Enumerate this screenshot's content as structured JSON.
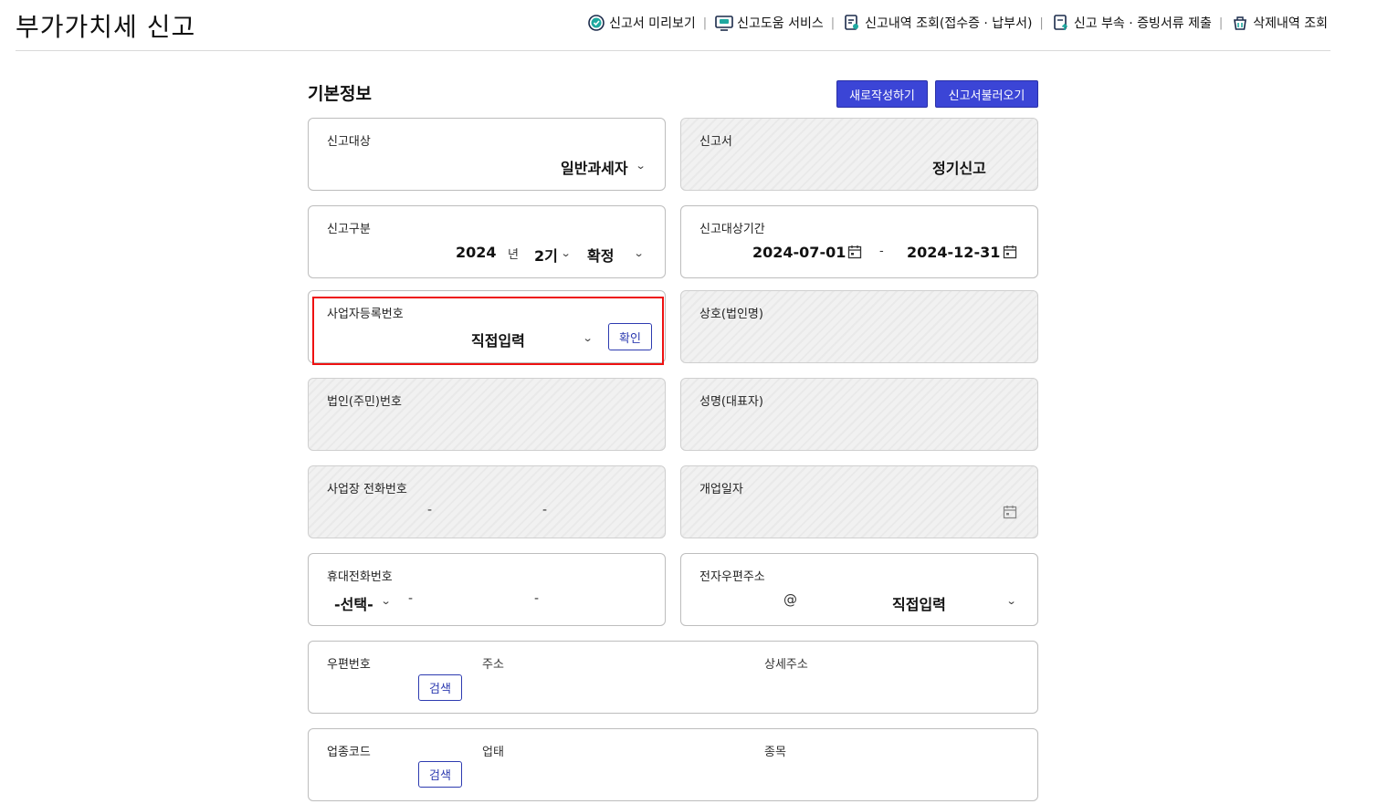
{
  "page_title": "부가가치세 신고",
  "nav": [
    {
      "label": "신고서 미리보기",
      "icon": "check-circle-icon"
    },
    {
      "label": "신고도움 서비스",
      "icon": "monitor-chat-icon"
    },
    {
      "label": "신고내역 조회(접수증 · 납부서)",
      "icon": "document-search-icon"
    },
    {
      "label": "신고 부속 · 증빙서류 제출",
      "icon": "document-upload-icon"
    },
    {
      "label": "삭제내역 조회",
      "icon": "trash-basket-icon"
    }
  ],
  "section_title": "기본정보",
  "buttons": {
    "new": "새로작성하기",
    "load": "신고서불러오기"
  },
  "fields": {
    "target": {
      "label": "신고대상",
      "value": "일반과세자"
    },
    "form": {
      "label": "신고서",
      "value": "정기신고"
    },
    "category": {
      "label": "신고구분",
      "year": "2024",
      "year_unit": "년",
      "period": "2기",
      "type": "확정"
    },
    "period_range": {
      "label": "신고대상기간",
      "start": "2024-07-01",
      "sep": "-",
      "end": "2024-12-31"
    },
    "biz_no": {
      "label": "사업자등록번호",
      "value": "직접입력",
      "confirm": "확인"
    },
    "company": {
      "label": "상호(법인명)"
    },
    "corp_no": {
      "label": "법인(주민)번호"
    },
    "rep_name": {
      "label": "성명(대표자)"
    },
    "phone": {
      "label": "사업장 전화번호",
      "dash": "-"
    },
    "open_date": {
      "label": "개업일자"
    },
    "mobile": {
      "label": "휴대전화번호",
      "select": "-선택-",
      "dash": "-"
    },
    "email": {
      "label": "전자우편주소",
      "at": "@",
      "domain": "직접입력"
    },
    "address": {
      "zip_label": "우편번호",
      "search": "검색",
      "addr_label": "주소",
      "detail_label": "상세주소"
    },
    "industry": {
      "code_label": "업종코드",
      "search": "검색",
      "type_label": "업태",
      "item_label": "종목"
    }
  },
  "colors": {
    "primary": "#3b45d6",
    "highlight": "#e11111",
    "outline": "#2d3bb0"
  }
}
